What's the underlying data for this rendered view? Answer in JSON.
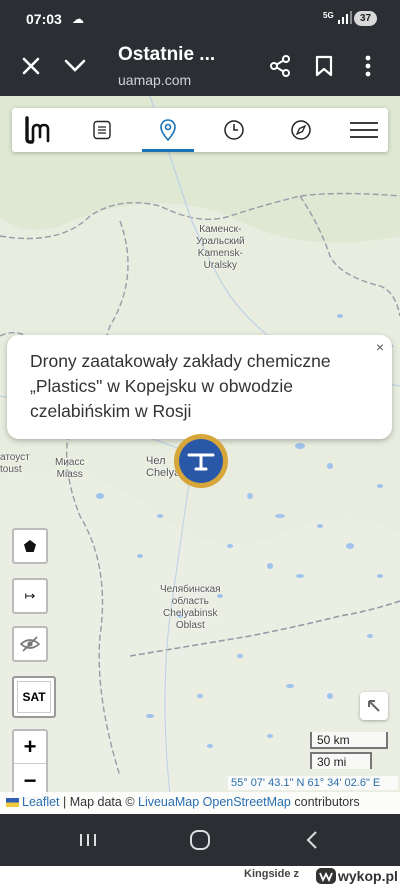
{
  "status_bar": {
    "time": "07:03",
    "network": "5G",
    "battery": "37"
  },
  "browser": {
    "title": "Ostatnie ...",
    "url": "uamap.com"
  },
  "toolbar": {
    "items": [
      "logo",
      "list",
      "location",
      "clock",
      "compass",
      "menu"
    ],
    "active_item": "location"
  },
  "map_labels": {
    "kamensk_ru": "Каменск-",
    "kamensk_ru2": "Уральский",
    "kamensk_lat": "Kamensk-",
    "kamensk_lat2": "Uralsky",
    "zlatoust_ru": "атоуст",
    "zlatoust_lat": "toust",
    "miass_ru": "Миасс",
    "miass_lat": "Miass",
    "chel_ru": "Чел",
    "chel_lat": "Chelyabinsk",
    "oblast_ru1": "Челябинская",
    "oblast_ru2": "область",
    "oblast_lat1": "Chelyabinsk",
    "oblast_lat2": "Oblast"
  },
  "popup": {
    "text": "Drony zaatakowały zakłady chemiczne „Plastics\" w Kopejsku w obwodzie czelabińskim w Rosji",
    "close": "×"
  },
  "controls": {
    "sat_label": "SAT",
    "zoom_in": "+",
    "zoom_out": "−",
    "line_tool": "↦"
  },
  "scale": {
    "km": "50 km",
    "mi": "30 mi"
  },
  "coordinates": "55° 07' 43.1\" N 61° 34' 02.6\" E",
  "attribution": {
    "leaflet": "Leaflet",
    "sep": " | Map data © ",
    "liveua": "LiveuaMap",
    "osm": "OpenStreetMap",
    "contrib": " contributors"
  },
  "watermark": {
    "user": "Kingside z",
    "site": "wykop.pl"
  },
  "colors": {
    "header": "#2b2e33",
    "accent": "#1a73b5",
    "marker_outer": "#d7a63b",
    "marker_inner": "#2a58a8"
  }
}
